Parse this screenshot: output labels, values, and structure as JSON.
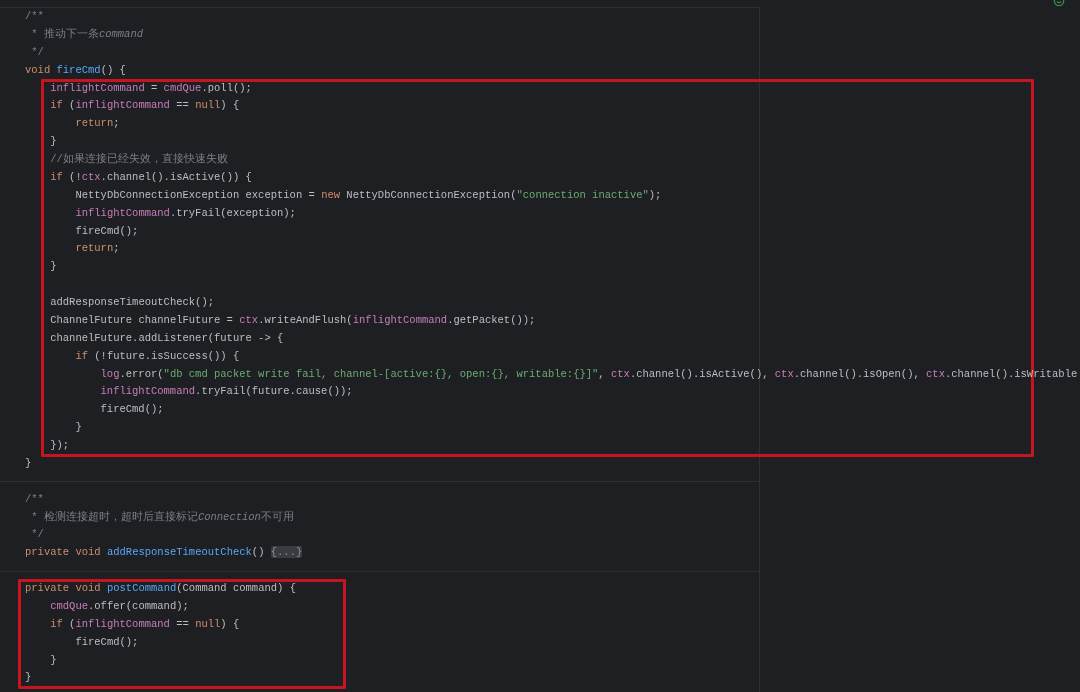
{
  "editor": {
    "lines": [
      {
        "kind": "code",
        "tokens": [
          {
            "kind": "comment",
            "text": "/**"
          }
        ]
      },
      {
        "kind": "code",
        "tokens": [
          {
            "kind": "comment",
            "text": " * 推动下一条"
          },
          {
            "kind": "comment_italic",
            "text": "command"
          }
        ]
      },
      {
        "kind": "code",
        "tokens": [
          {
            "kind": "comment",
            "text": " */"
          }
        ]
      },
      {
        "kind": "code",
        "tokens": [
          {
            "kind": "keyword",
            "text": "void "
          },
          {
            "kind": "function",
            "text": "fireCmd"
          },
          {
            "kind": "plain",
            "text": "() {"
          }
        ],
        "children": [
          {
            "kind": "group",
            "highlighted": true,
            "lines": [
              {
                "kind": "code",
                "tokens": [
                  {
                    "kind": "field",
                    "text": "inflightCommand"
                  },
                  {
                    "kind": "plain",
                    "text": " = "
                  },
                  {
                    "kind": "field",
                    "text": "cmdQue"
                  },
                  {
                    "kind": "plain",
                    "text": ".poll();"
                  }
                ]
              },
              {
                "kind": "code",
                "tokens": [
                  {
                    "kind": "keyword",
                    "text": "if "
                  },
                  {
                    "kind": "plain",
                    "text": "("
                  },
                  {
                    "kind": "field",
                    "text": "inflightCommand"
                  },
                  {
                    "kind": "plain",
                    "text": " == "
                  },
                  {
                    "kind": "keyword",
                    "text": "null"
                  },
                  {
                    "kind": "plain",
                    "text": ") {"
                  }
                ],
                "children": [
                  {
                    "kind": "code",
                    "tokens": [
                      {
                        "kind": "keyword",
                        "text": "return"
                      },
                      {
                        "kind": "plain",
                        "text": ";"
                      }
                    ]
                  }
                ]
              },
              {
                "kind": "code",
                "tokens": [
                  {
                    "kind": "plain",
                    "text": "}"
                  }
                ]
              },
              {
                "kind": "code",
                "tokens": [
                  {
                    "kind": "comment",
                    "text": "//如果连接已经失效，直接快速失败"
                  }
                ]
              },
              {
                "kind": "code",
                "tokens": [
                  {
                    "kind": "keyword",
                    "text": "if "
                  },
                  {
                    "kind": "plain",
                    "text": "(!"
                  },
                  {
                    "kind": "field",
                    "text": "ctx"
                  },
                  {
                    "kind": "plain",
                    "text": ".channel().isActive()) {"
                  }
                ],
                "children": [
                  {
                    "kind": "code",
                    "tokens": [
                      {
                        "kind": "plain",
                        "text": "NettyDbConnectionException exception = "
                      },
                      {
                        "kind": "keyword",
                        "text": "new "
                      },
                      {
                        "kind": "plain",
                        "text": "NettyDbConnectionException("
                      },
                      {
                        "kind": "string",
                        "text": "\"connection inactive\""
                      },
                      {
                        "kind": "plain",
                        "text": ");"
                      }
                    ]
                  },
                  {
                    "kind": "code",
                    "tokens": [
                      {
                        "kind": "field",
                        "text": "inflightCommand"
                      },
                      {
                        "kind": "plain",
                        "text": ".tryFail(exception);"
                      }
                    ]
                  },
                  {
                    "kind": "code",
                    "tokens": [
                      {
                        "kind": "plain",
                        "text": "fireCmd();"
                      }
                    ]
                  },
                  {
                    "kind": "code",
                    "tokens": [
                      {
                        "kind": "keyword",
                        "text": "return"
                      },
                      {
                        "kind": "plain",
                        "text": ";"
                      }
                    ]
                  }
                ]
              },
              {
                "kind": "code",
                "tokens": [
                  {
                    "kind": "plain",
                    "text": "}"
                  }
                ]
              },
              {
                "kind": "blank"
              },
              {
                "kind": "code",
                "tokens": [
                  {
                    "kind": "plain",
                    "text": "addResponseTimeoutCheck();"
                  }
                ]
              },
              {
                "kind": "code",
                "tokens": [
                  {
                    "kind": "plain",
                    "text": "ChannelFuture channelFuture = "
                  },
                  {
                    "kind": "field",
                    "text": "ctx"
                  },
                  {
                    "kind": "plain",
                    "text": ".writeAndFlush("
                  },
                  {
                    "kind": "field",
                    "text": "inflightCommand"
                  },
                  {
                    "kind": "plain",
                    "text": ".getPacket());"
                  }
                ]
              },
              {
                "kind": "code",
                "tokens": [
                  {
                    "kind": "plain",
                    "text": "channelFuture.addListener(future -> {"
                  }
                ],
                "children": [
                  {
                    "kind": "code",
                    "tokens": [
                      {
                        "kind": "keyword",
                        "text": "if "
                      },
                      {
                        "kind": "plain",
                        "text": "(!future.isSuccess()) {"
                      }
                    ],
                    "children": [
                      {
                        "kind": "code",
                        "tokens": [
                          {
                            "kind": "field",
                            "text": "log"
                          },
                          {
                            "kind": "plain",
                            "text": ".error("
                          },
                          {
                            "kind": "string",
                            "text": "\"db cmd packet write fail, channel-[active:{}, open:{}, writable:{}]\""
                          },
                          {
                            "kind": "plain",
                            "text": ", "
                          },
                          {
                            "kind": "field",
                            "text": "ctx"
                          },
                          {
                            "kind": "plain",
                            "text": ".channel().isActive(), "
                          },
                          {
                            "kind": "field",
                            "text": "ctx"
                          },
                          {
                            "kind": "plain",
                            "text": ".channel().isOpen(), "
                          },
                          {
                            "kind": "field",
                            "text": "ctx"
                          },
                          {
                            "kind": "plain",
                            "text": ".channel().isWritable"
                          }
                        ]
                      },
                      {
                        "kind": "code",
                        "tokens": [
                          {
                            "kind": "field",
                            "text": "inflightCommand"
                          },
                          {
                            "kind": "plain",
                            "text": ".tryFail(future.cause());"
                          }
                        ]
                      },
                      {
                        "kind": "code",
                        "tokens": [
                          {
                            "kind": "plain",
                            "text": "fireCmd();"
                          }
                        ]
                      }
                    ]
                  },
                  {
                    "kind": "code",
                    "tokens": [
                      {
                        "kind": "plain",
                        "text": "}"
                      }
                    ]
                  }
                ]
              },
              {
                "kind": "code",
                "tokens": [
                  {
                    "kind": "plain",
                    "text": "});"
                  }
                ]
              }
            ]
          }
        ]
      },
      {
        "kind": "code",
        "tokens": [
          {
            "kind": "plain",
            "text": "}"
          }
        ]
      },
      {
        "kind": "separator"
      },
      {
        "kind": "code",
        "tokens": [
          {
            "kind": "comment",
            "text": "/**"
          }
        ]
      },
      {
        "kind": "code",
        "tokens": [
          {
            "kind": "comment",
            "text": " * 检测连接超时，超时后直接标记"
          },
          {
            "kind": "comment_italic",
            "text": "Connection"
          },
          {
            "kind": "comment",
            "text": "不可用"
          }
        ]
      },
      {
        "kind": "code",
        "tokens": [
          {
            "kind": "comment",
            "text": " */"
          }
        ]
      },
      {
        "kind": "code",
        "tokens": [
          {
            "kind": "keyword",
            "text": "private void "
          },
          {
            "kind": "function",
            "text": "addResponseTimeoutCheck"
          },
          {
            "kind": "plain",
            "text": "() "
          },
          {
            "kind": "fold",
            "text": "{...}"
          }
        ]
      },
      {
        "kind": "separator"
      },
      {
        "kind": "group",
        "highlighted": true,
        "lines": [
          {
            "kind": "code",
            "tokens": [
              {
                "kind": "keyword",
                "text": "private void "
              },
              {
                "kind": "function",
                "text": "postCommand"
              },
              {
                "kind": "plain",
                "text": "(Command command) {"
              }
            ],
            "children": [
              {
                "kind": "code",
                "tokens": [
                  {
                    "kind": "field",
                    "text": "cmdQue"
                  },
                  {
                    "kind": "plain",
                    "text": ".offer(command);"
                  }
                ]
              },
              {
                "kind": "code",
                "tokens": [
                  {
                    "kind": "keyword",
                    "text": "if "
                  },
                  {
                    "kind": "plain",
                    "text": "("
                  },
                  {
                    "kind": "field",
                    "text": "inflightCommand"
                  },
                  {
                    "kind": "plain",
                    "text": " == "
                  },
                  {
                    "kind": "keyword",
                    "text": "null"
                  },
                  {
                    "kind": "plain",
                    "text": ") {"
                  }
                ],
                "children": [
                  {
                    "kind": "code",
                    "tokens": [
                      {
                        "kind": "plain",
                        "text": "fireCmd();"
                      }
                    ]
                  }
                ]
              },
              {
                "kind": "code",
                "tokens": [
                  {
                    "kind": "plain",
                    "text": "}"
                  }
                ]
              }
            ]
          },
          {
            "kind": "code",
            "tokens": [
              {
                "kind": "plain",
                "text": "}"
              }
            ]
          }
        ]
      }
    ]
  }
}
